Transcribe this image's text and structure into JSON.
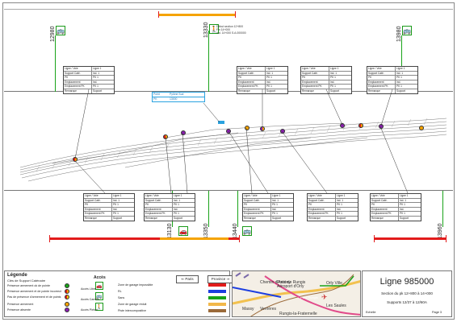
{
  "kp_labels": {
    "kp1": "12980",
    "kp2": "13130",
    "kp3": "13330",
    "kp4": "13350",
    "kp5": "13440",
    "kp6": "13960",
    "kp7": "13980"
  },
  "top_callout": {
    "line1": "Début section 12+800",
    "line2": "Fin 14+000",
    "line3": "Ind. 14+000  S.A.000000"
  },
  "table_labels": {
    "r1": [
      "Ligne / Voie",
      "Ligne 1"
    ],
    "r2": [
      "Support Caté.",
      "Ind. 1"
    ],
    "r3": [
      "PK",
      "PK 1"
    ],
    "r4": [
      "Emplacement",
      "Ind."
    ],
    "r5": [
      "Emplacement PK",
      "PK 1"
    ],
    "r6": [
      "Remarque",
      "Support"
    ]
  },
  "blue_callout": {
    "k1": "Point",
    "v1": "Pylône Sud",
    "k2": "PK",
    "v2": "13000"
  },
  "legend": {
    "title": "Légende",
    "subtitle": "Clés de Support Caténaire",
    "acces_title": "Accès",
    "rows": [
      "Présence armement ok de pointe",
      "Présence armement et de pointe incorrect",
      "Pas de présence d'armement et de points",
      "Présence armement",
      "Présence absente"
    ],
    "acces": [
      "Accès Libre",
      "Accès Camion",
      "Accès Piéton"
    ],
    "zones": [
      "Zone de garage impossible",
      "RL",
      "Sans",
      "Zone de garage réduit",
      "Piste intercompositive"
    ],
    "colors": {
      "green": "#19a319",
      "red": "#e21b1b",
      "orange": "#f5a300",
      "purple": "#8b1fb0",
      "yellow": "#f0d000",
      "blue": "#1c3ee0",
      "brown": "#9b6a3a",
      "sand": "#f2b84a"
    }
  },
  "nav": {
    "prev": "Paris",
    "next": "Province"
  },
  "map": {
    "l1": "Chemin d'Antony",
    "l2": "Point de Rungis Aéroport d'Orly",
    "l3": "Orly Ville",
    "l4": "Massy",
    "l5": "Verrières",
    "l6": "Rungis-la-Fraternelle",
    "l7": "Les Saules",
    "l8": "Pont Rungis"
  },
  "title_block": {
    "line": "Ligne 985000",
    "section": "Section du pk 12+800 à 14+000",
    "supports": "Supports 12/37 à 12/60A",
    "echelle": "Echelle",
    "page": "Page 3"
  }
}
